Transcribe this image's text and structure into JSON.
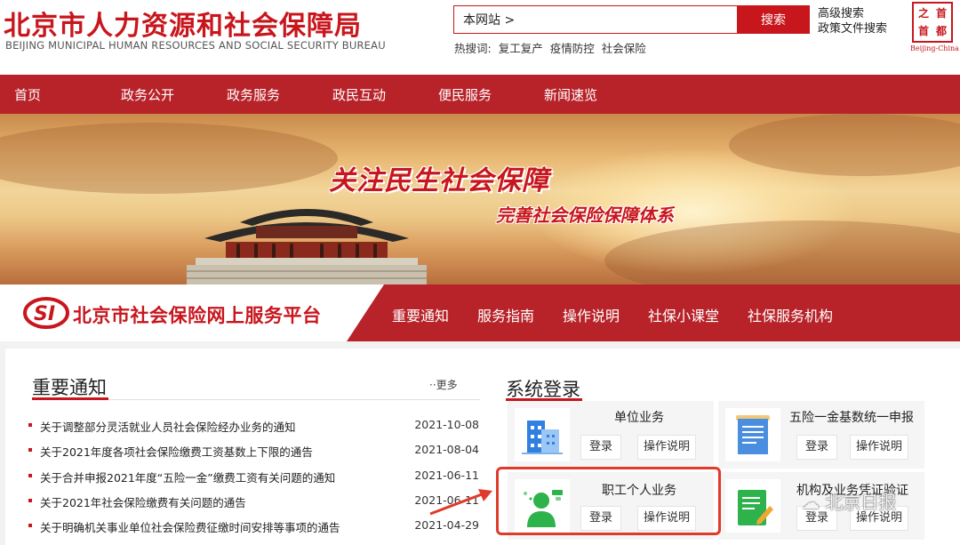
{
  "header": {
    "logo_cn": "北京市人力资源和社会保障局",
    "logo_en": "BEIJING MUNICIPAL HUMAN RESOURCES AND SOCIAL SECURITY BUREAU",
    "search_value": "本网站 >",
    "search_button": "搜索",
    "hot_label": "热搜词:",
    "hot_words": [
      "复工复产",
      "疫情防控",
      "社会保险"
    ],
    "advanced_search": "高级搜索",
    "policy_search": "政策文件搜索",
    "seal_chars": [
      "之",
      "首",
      "首",
      "都"
    ],
    "seal_sub": "Beijing-China"
  },
  "nav": {
    "items": [
      "首页",
      "政务公开",
      "政务服务",
      "政民互动",
      "便民服务",
      "新闻速览"
    ]
  },
  "banner": {
    "slogan1": "关注民生社会保障",
    "slogan2": "完善社会保险保障体系"
  },
  "platform": {
    "title": "北京市社会保险网上服务平台",
    "nav": [
      "重要通知",
      "服务指南",
      "操作说明",
      "社保小课堂",
      "社保服务机构"
    ]
  },
  "notices": {
    "title": "重要通知",
    "more": "··更多",
    "items": [
      {
        "title": "关于调整部分灵活就业人员社会保险经办业务的通知",
        "date": "2021-10-08"
      },
      {
        "title": "关于2021年度各项社会保险缴费工资基数上下限的通告",
        "date": "2021-08-04"
      },
      {
        "title": "关于合并申报2021年度“五险一金”缴费工资有关问题的通知",
        "date": "2021-06-11"
      },
      {
        "title": "关于2021年社会保险缴费有关问题的通告",
        "date": "2021-06-11"
      },
      {
        "title": "关于明确机关事业单位社会保险费征缴时间安排等事项的通告",
        "date": "2021-04-29"
      }
    ]
  },
  "login": {
    "title": "系统登录",
    "cards": [
      {
        "title": "单位业务",
        "login": "登录",
        "guide": "操作说明"
      },
      {
        "title": "五险一金基数统一申报",
        "login": "登录",
        "guide": "操作说明"
      },
      {
        "title": "职工个人业务",
        "login": "登录",
        "guide": "操作说明"
      },
      {
        "title": "机构及业务凭证验证",
        "login": "登录",
        "guide": "操作说明"
      }
    ]
  },
  "watermark": "北京日报",
  "colors": {
    "brand_red": "#c8161d",
    "nav_red": "#b8232a",
    "highlight": "#e03a2b"
  }
}
